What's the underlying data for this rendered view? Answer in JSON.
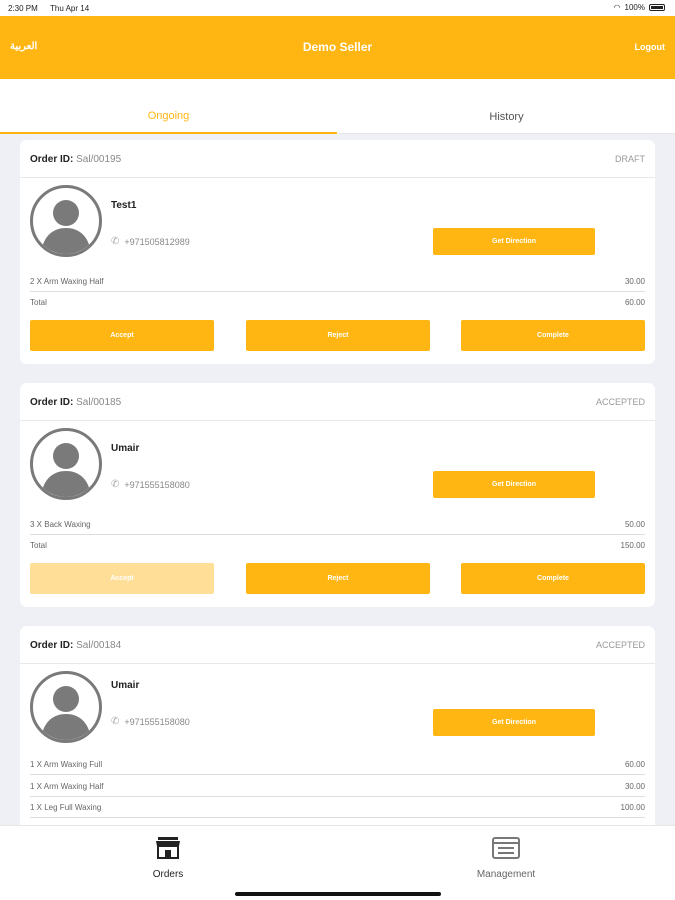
{
  "status_bar": {
    "time": "2:30 PM",
    "date": "Thu Apr 14",
    "battery": "100%"
  },
  "header": {
    "language": "العربية",
    "title": "Demo Seller",
    "logout": "Logout",
    "color": "#ffb612"
  },
  "tabs": [
    {
      "label": "Ongoing",
      "active": true
    },
    {
      "label": "History",
      "active": false
    }
  ],
  "labels": {
    "order_id": "Order ID:",
    "total": "Total",
    "get_direction": "Get Direction",
    "accept": "Accept",
    "reject": "Reject",
    "complete": "Complete"
  },
  "orders": [
    {
      "id": "Sal/00195",
      "status": "DRAFT",
      "customer": "Test1",
      "phone": "+971505812989",
      "items": [
        {
          "name": "2 X Arm Waxing Half",
          "price": "30.00"
        }
      ],
      "total": "60.00",
      "accept_enabled": true
    },
    {
      "id": "Sal/00185",
      "status": "ACCEPTED",
      "customer": "Umair",
      "phone": "+971555158080",
      "items": [
        {
          "name": "3 X Back Waxing",
          "price": "50.00"
        }
      ],
      "total": "150.00",
      "accept_enabled": false
    },
    {
      "id": "Sal/00184",
      "status": "ACCEPTED",
      "customer": "Umair",
      "phone": "+971555158080",
      "items": [
        {
          "name": "1 X Arm Waxing Full",
          "price": "60.00"
        },
        {
          "name": "1 X Arm Waxing Half",
          "price": "30.00"
        },
        {
          "name": "1 X Leg Full Waxing",
          "price": "100.00"
        }
      ]
    }
  ],
  "bottom_nav": [
    {
      "label": "Orders",
      "icon": "store-icon"
    },
    {
      "label": "Management",
      "icon": "management-icon"
    }
  ]
}
